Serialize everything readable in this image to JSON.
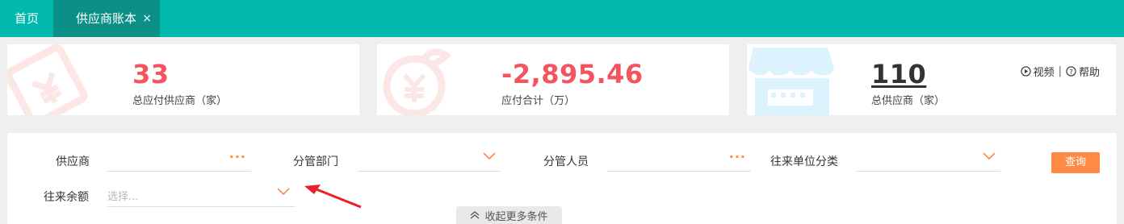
{
  "tabs": [
    {
      "label": "首页"
    },
    {
      "label": "供应商账本",
      "close": "×"
    }
  ],
  "stats": [
    {
      "value": "33",
      "label": "总应付供应商（家）"
    },
    {
      "value": "-2,895.46",
      "label": "应付合计（万）"
    },
    {
      "value": "110",
      "label": "总供应商（家）"
    }
  ],
  "help": {
    "video": "视频",
    "separator": "|",
    "help": "帮助"
  },
  "filters": {
    "supplier": {
      "label": "供应商",
      "value": "",
      "trigger": "···"
    },
    "dept": {
      "label": "分管部门",
      "value": ""
    },
    "staff": {
      "label": "分管人员",
      "value": "",
      "trigger": "···"
    },
    "category": {
      "label": "往来单位分类",
      "value": ""
    },
    "balance": {
      "label": "往来余额",
      "placeholder": "选择..."
    }
  },
  "buttons": {
    "query": "查询",
    "collapse": "收起更多条件"
  },
  "colors": {
    "primary": "#00b8ab",
    "active_tab": "#0b9088",
    "accent": "#ff8a45",
    "stat_red": "#f4545d"
  }
}
